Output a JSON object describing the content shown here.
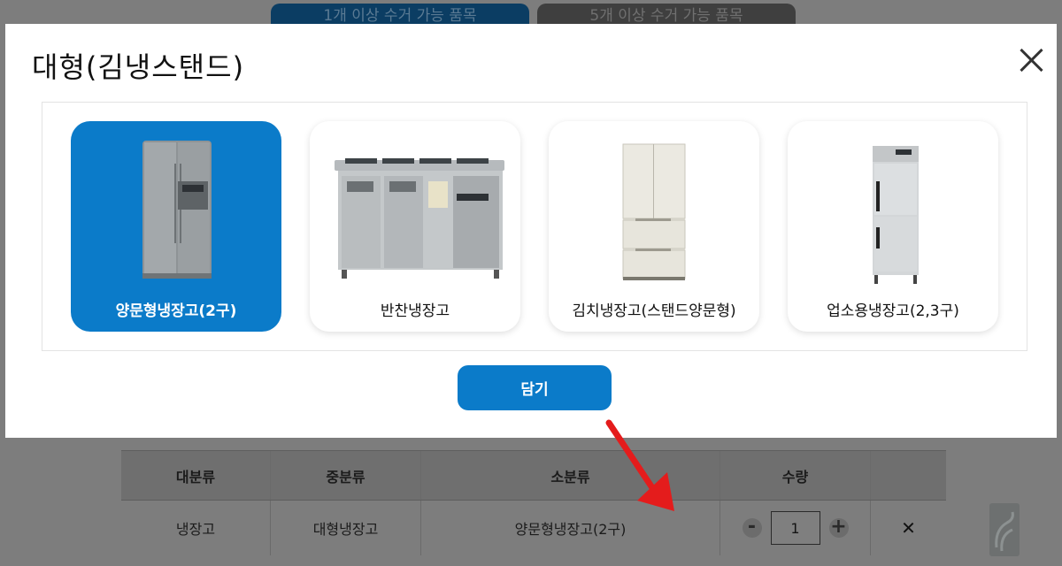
{
  "background": {
    "tabs": [
      "1개 이상 수거 가능 품목",
      "5개 이상 수거 가능 품목"
    ],
    "table": {
      "headers": [
        "대분류",
        "중분류",
        "소분류",
        "수량",
        ""
      ],
      "row": {
        "category_large": "냉장고",
        "category_mid": "대형냉장고",
        "category_small": "양문형냉장고(2구)",
        "qty_minus": "-",
        "qty_value": "1",
        "qty_plus": "+",
        "remove": "✕"
      }
    }
  },
  "modal": {
    "title": "대형(김냉스탠드)",
    "close_icon": "close-icon",
    "items": [
      {
        "label": "양문형냉장고(2구)",
        "selected": true,
        "icon": "side-by-side-fridge"
      },
      {
        "label": "반찬냉장고",
        "selected": false,
        "icon": "side-dish-fridge"
      },
      {
        "label": "김치냉장고(스탠드양문형)",
        "selected": false,
        "icon": "kimchi-fridge"
      },
      {
        "label": "업소용냉장고(2,3구)",
        "selected": false,
        "icon": "commercial-fridge"
      }
    ],
    "add_button": "담기"
  },
  "colors": {
    "accent": "#0b7bc9",
    "arrow": "#e41c1c"
  }
}
